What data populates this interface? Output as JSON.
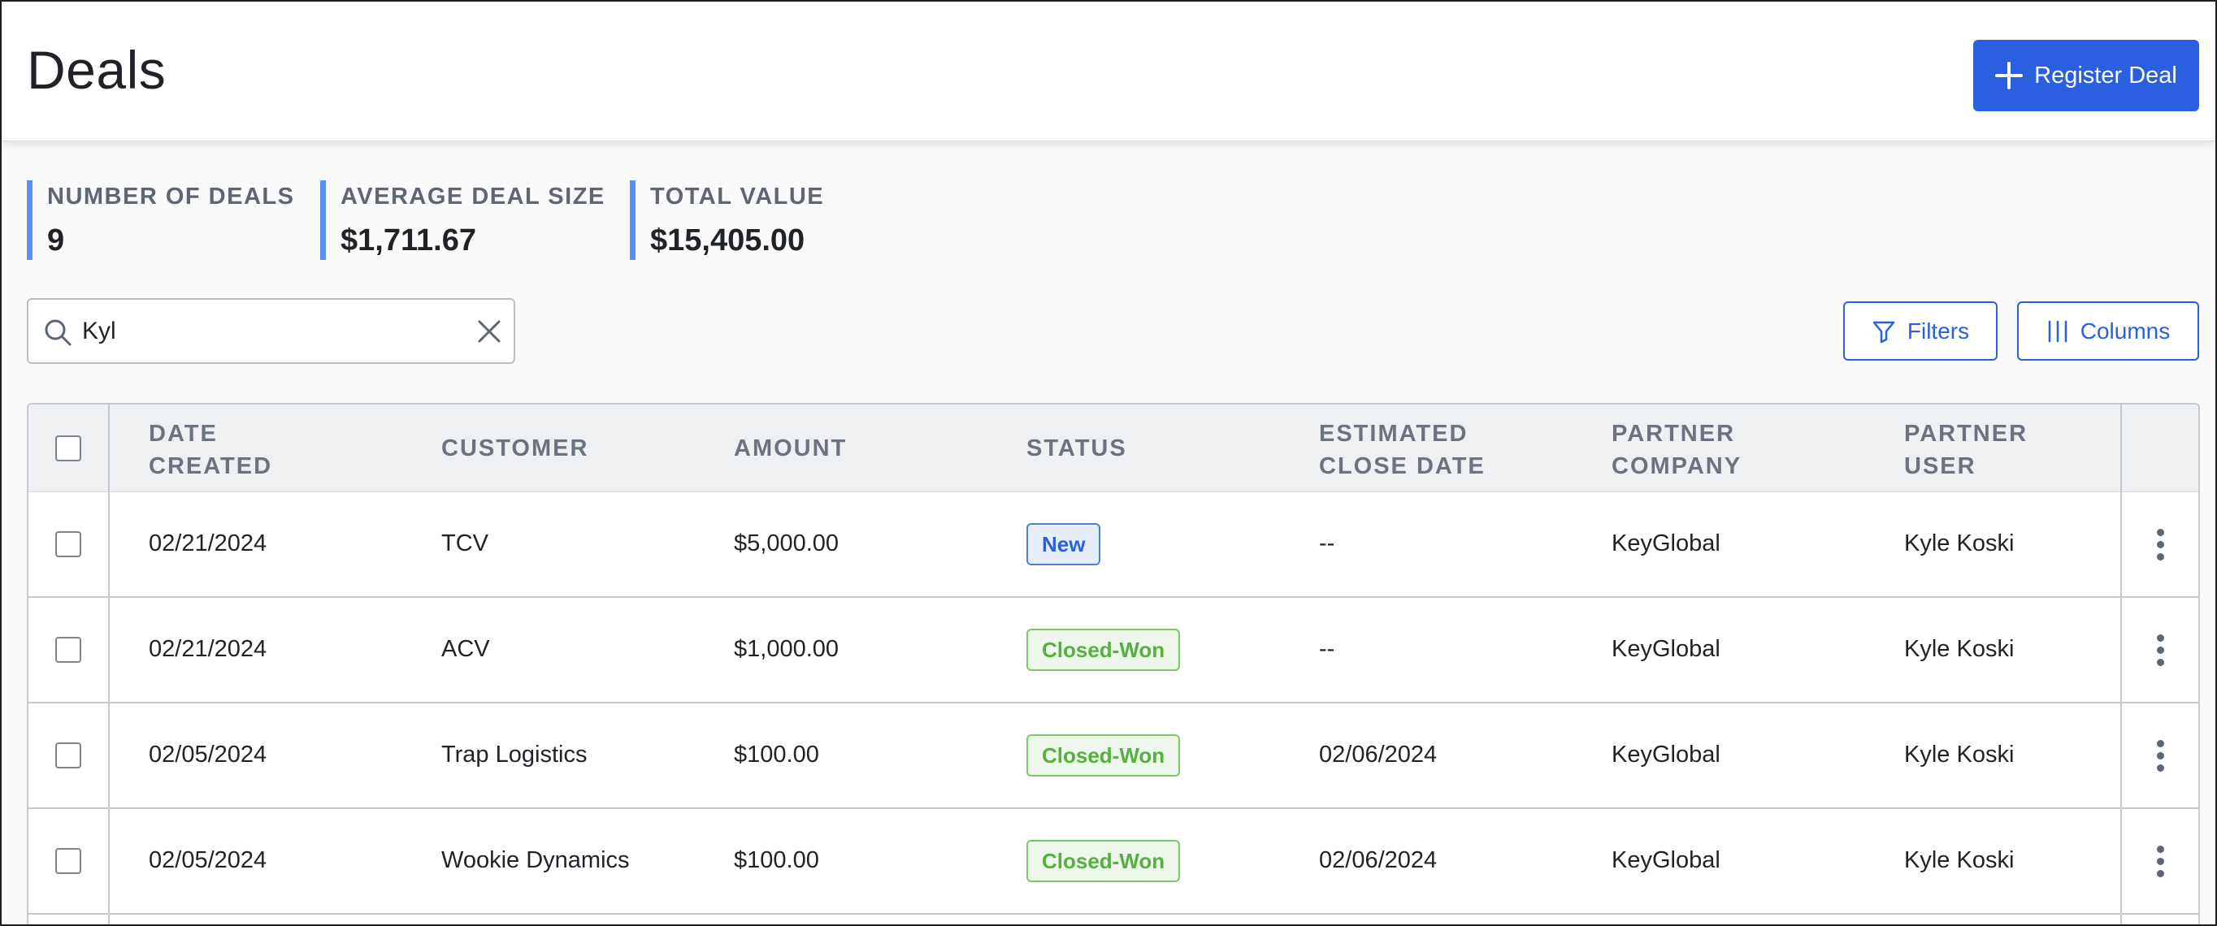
{
  "header": {
    "title": "Deals",
    "register_label": "Register Deal"
  },
  "stats": [
    {
      "label": "NUMBER OF DEALS",
      "value": "9"
    },
    {
      "label": "AVERAGE DEAL SIZE",
      "value": "$1,711.67"
    },
    {
      "label": "TOTAL VALUE",
      "value": "$15,405.00"
    }
  ],
  "search": {
    "value": "Kyl"
  },
  "toolbar": {
    "filters_label": "Filters",
    "columns_label": "Columns"
  },
  "table": {
    "columns": [
      {
        "line1": "DATE",
        "line2": "CREATED"
      },
      {
        "line1": "CUSTOMER",
        "line2": ""
      },
      {
        "line1": "AMOUNT",
        "line2": ""
      },
      {
        "line1": "STATUS",
        "line2": ""
      },
      {
        "line1": "ESTIMATED",
        "line2": "CLOSE DATE"
      },
      {
        "line1": "PARTNER",
        "line2": "COMPANY"
      },
      {
        "line1": "PARTNER",
        "line2": "USER"
      }
    ],
    "rows": [
      {
        "date": "02/21/2024",
        "customer": "TCV",
        "amount": "$5,000.00",
        "status": "New",
        "close_date": "--",
        "company": "KeyGlobal",
        "user": "Kyle Koski"
      },
      {
        "date": "02/21/2024",
        "customer": "ACV",
        "amount": "$1,000.00",
        "status": "Closed-Won",
        "close_date": "--",
        "company": "KeyGlobal",
        "user": "Kyle Koski"
      },
      {
        "date": "02/05/2024",
        "customer": "Trap Logistics",
        "amount": "$100.00",
        "status": "Closed-Won",
        "close_date": "02/06/2024",
        "company": "KeyGlobal",
        "user": "Kyle Koski"
      },
      {
        "date": "02/05/2024",
        "customer": "Wookie Dynamics",
        "amount": "$100.00",
        "status": "Closed-Won",
        "close_date": "02/06/2024",
        "company": "KeyGlobal",
        "user": "Kyle Koski"
      }
    ]
  },
  "colors": {
    "primary": "#2a5fe0",
    "stat_accent": "#5c8ff0",
    "badge_new_text": "#2a5fe0",
    "badge_won_text": "#55b040"
  }
}
